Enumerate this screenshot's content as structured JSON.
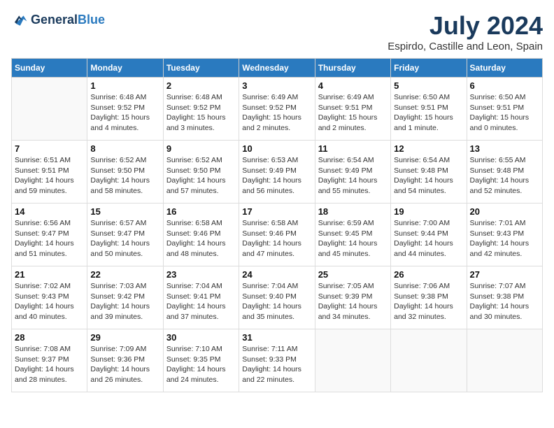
{
  "header": {
    "logo_general": "General",
    "logo_blue": "Blue",
    "month_year": "July 2024",
    "location": "Espirdo, Castille and Leon, Spain"
  },
  "weekdays": [
    "Sunday",
    "Monday",
    "Tuesday",
    "Wednesday",
    "Thursday",
    "Friday",
    "Saturday"
  ],
  "weeks": [
    [
      {
        "day": "",
        "info": ""
      },
      {
        "day": "1",
        "info": "Sunrise: 6:48 AM\nSunset: 9:52 PM\nDaylight: 15 hours\nand 4 minutes."
      },
      {
        "day": "2",
        "info": "Sunrise: 6:48 AM\nSunset: 9:52 PM\nDaylight: 15 hours\nand 3 minutes."
      },
      {
        "day": "3",
        "info": "Sunrise: 6:49 AM\nSunset: 9:52 PM\nDaylight: 15 hours\nand 2 minutes."
      },
      {
        "day": "4",
        "info": "Sunrise: 6:49 AM\nSunset: 9:51 PM\nDaylight: 15 hours\nand 2 minutes."
      },
      {
        "day": "5",
        "info": "Sunrise: 6:50 AM\nSunset: 9:51 PM\nDaylight: 15 hours\nand 1 minute."
      },
      {
        "day": "6",
        "info": "Sunrise: 6:50 AM\nSunset: 9:51 PM\nDaylight: 15 hours\nand 0 minutes."
      }
    ],
    [
      {
        "day": "7",
        "info": "Sunrise: 6:51 AM\nSunset: 9:51 PM\nDaylight: 14 hours\nand 59 minutes."
      },
      {
        "day": "8",
        "info": "Sunrise: 6:52 AM\nSunset: 9:50 PM\nDaylight: 14 hours\nand 58 minutes."
      },
      {
        "day": "9",
        "info": "Sunrise: 6:52 AM\nSunset: 9:50 PM\nDaylight: 14 hours\nand 57 minutes."
      },
      {
        "day": "10",
        "info": "Sunrise: 6:53 AM\nSunset: 9:49 PM\nDaylight: 14 hours\nand 56 minutes."
      },
      {
        "day": "11",
        "info": "Sunrise: 6:54 AM\nSunset: 9:49 PM\nDaylight: 14 hours\nand 55 minutes."
      },
      {
        "day": "12",
        "info": "Sunrise: 6:54 AM\nSunset: 9:48 PM\nDaylight: 14 hours\nand 54 minutes."
      },
      {
        "day": "13",
        "info": "Sunrise: 6:55 AM\nSunset: 9:48 PM\nDaylight: 14 hours\nand 52 minutes."
      }
    ],
    [
      {
        "day": "14",
        "info": "Sunrise: 6:56 AM\nSunset: 9:47 PM\nDaylight: 14 hours\nand 51 minutes."
      },
      {
        "day": "15",
        "info": "Sunrise: 6:57 AM\nSunset: 9:47 PM\nDaylight: 14 hours\nand 50 minutes."
      },
      {
        "day": "16",
        "info": "Sunrise: 6:58 AM\nSunset: 9:46 PM\nDaylight: 14 hours\nand 48 minutes."
      },
      {
        "day": "17",
        "info": "Sunrise: 6:58 AM\nSunset: 9:46 PM\nDaylight: 14 hours\nand 47 minutes."
      },
      {
        "day": "18",
        "info": "Sunrise: 6:59 AM\nSunset: 9:45 PM\nDaylight: 14 hours\nand 45 minutes."
      },
      {
        "day": "19",
        "info": "Sunrise: 7:00 AM\nSunset: 9:44 PM\nDaylight: 14 hours\nand 44 minutes."
      },
      {
        "day": "20",
        "info": "Sunrise: 7:01 AM\nSunset: 9:43 PM\nDaylight: 14 hours\nand 42 minutes."
      }
    ],
    [
      {
        "day": "21",
        "info": "Sunrise: 7:02 AM\nSunset: 9:43 PM\nDaylight: 14 hours\nand 40 minutes."
      },
      {
        "day": "22",
        "info": "Sunrise: 7:03 AM\nSunset: 9:42 PM\nDaylight: 14 hours\nand 39 minutes."
      },
      {
        "day": "23",
        "info": "Sunrise: 7:04 AM\nSunset: 9:41 PM\nDaylight: 14 hours\nand 37 minutes."
      },
      {
        "day": "24",
        "info": "Sunrise: 7:04 AM\nSunset: 9:40 PM\nDaylight: 14 hours\nand 35 minutes."
      },
      {
        "day": "25",
        "info": "Sunrise: 7:05 AM\nSunset: 9:39 PM\nDaylight: 14 hours\nand 34 minutes."
      },
      {
        "day": "26",
        "info": "Sunrise: 7:06 AM\nSunset: 9:38 PM\nDaylight: 14 hours\nand 32 minutes."
      },
      {
        "day": "27",
        "info": "Sunrise: 7:07 AM\nSunset: 9:38 PM\nDaylight: 14 hours\nand 30 minutes."
      }
    ],
    [
      {
        "day": "28",
        "info": "Sunrise: 7:08 AM\nSunset: 9:37 PM\nDaylight: 14 hours\nand 28 minutes."
      },
      {
        "day": "29",
        "info": "Sunrise: 7:09 AM\nSunset: 9:36 PM\nDaylight: 14 hours\nand 26 minutes."
      },
      {
        "day": "30",
        "info": "Sunrise: 7:10 AM\nSunset: 9:35 PM\nDaylight: 14 hours\nand 24 minutes."
      },
      {
        "day": "31",
        "info": "Sunrise: 7:11 AM\nSunset: 9:33 PM\nDaylight: 14 hours\nand 22 minutes."
      },
      {
        "day": "",
        "info": ""
      },
      {
        "day": "",
        "info": ""
      },
      {
        "day": "",
        "info": ""
      }
    ]
  ]
}
